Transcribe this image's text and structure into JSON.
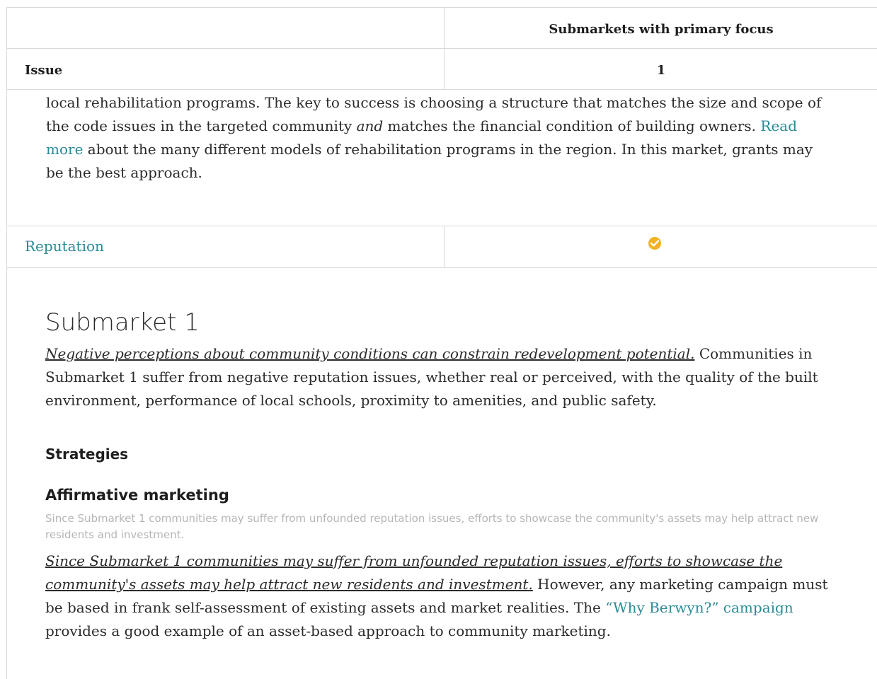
{
  "table": {
    "header_col2": "Submarkets with primary focus",
    "subheader_issue": "Issue",
    "subheader_col2": "1",
    "expanded_text": {
      "p1": "local rehabilitation programs. The key to success is choosing a structure that matches the size and scope of the code issues in the targeted community ",
      "p1_em": "and",
      "p1b": " matches the financial condition of building owners. ",
      "link": "Read more",
      "p2": " about the many different models of rehabilitation programs in the region. In this market, grants may be the best approach."
    },
    "row_reputation_label": "Reputation",
    "row_reputation_icon": "check-circle-icon"
  },
  "submarket": {
    "heading": "Submarket 1",
    "intro_em": "Negative perceptions about community conditions can constrain redevelopment potential.",
    "intro_rest": " Communities in Submarket 1 suffer from negative reputation issues, whether real or perceived, with the quality of the built environment, performance of local schools, proximity to amenities, and public safety.",
    "strategies_heading": "Strategies",
    "strategy_title": "Affirmative marketing",
    "strategy_summary": "Since Submarket 1 communities may suffer from unfounded reputation issues, efforts to showcase the community's assets may help attract new residents and investment.",
    "strategy_em": "Since Submarket 1 communities may suffer from unfounded reputation issues, efforts to showcase the community's assets may help attract new residents and investment.",
    "strategy_rest": " However, any marketing campaign must be based in frank self-assessment of existing assets and market realities. The ",
    "strategy_link": "“Why Berwyn?” campaign",
    "strategy_end": " provides a good example of an asset-based approach to community marketing."
  },
  "colors": {
    "link": "#2a8a95",
    "check": "#f0b41f",
    "muted": "#b5b5b5"
  }
}
